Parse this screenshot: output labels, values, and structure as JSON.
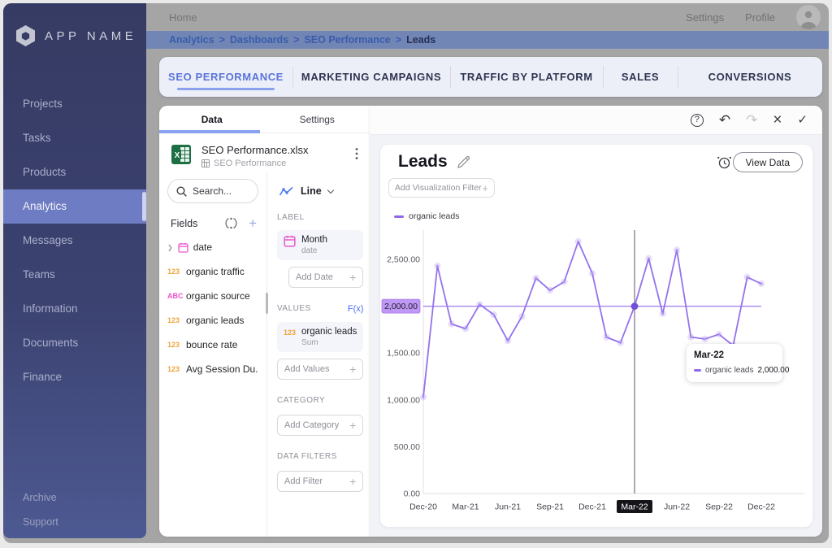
{
  "sidebar": {
    "logo_text": "APP NAME",
    "items": [
      {
        "label": "Projects"
      },
      {
        "label": "Tasks"
      },
      {
        "label": "Products"
      },
      {
        "label": "Analytics",
        "active": true
      },
      {
        "label": "Messages"
      },
      {
        "label": "Teams"
      },
      {
        "label": "Information"
      },
      {
        "label": "Documents"
      },
      {
        "label": "Finance"
      }
    ],
    "footer_items": [
      {
        "label": "Archive"
      },
      {
        "label": "Support"
      }
    ]
  },
  "topbar": {
    "home": "Home",
    "settings": "Settings",
    "profile": "Profile"
  },
  "breadcrumb": {
    "items": [
      "Analytics",
      "Dashboards",
      "SEO Performance"
    ],
    "separator": ">",
    "current": "Leads"
  },
  "tabs": [
    {
      "label": "SEO PERFORMANCE",
      "active": true
    },
    {
      "label": "MARKETING CAMPAIGNS"
    },
    {
      "label": "TRAFFIC BY PLATFORM"
    },
    {
      "label": "SALES"
    },
    {
      "label": "CONVERSIONS"
    }
  ],
  "data_panel": {
    "tabs": [
      "Data",
      "Settings"
    ],
    "file": {
      "name": "SEO Performance.xlsx",
      "sheet": "SEO Performance"
    },
    "search_placeholder": "Search...",
    "fields_label": "Fields",
    "fields": [
      {
        "icon": "calendar",
        "label": "date",
        "expandable": true
      },
      {
        "badge": "123",
        "label": "organic traffic"
      },
      {
        "badge": "ABC",
        "label": "organic source"
      },
      {
        "badge": "123",
        "label": "organic leads"
      },
      {
        "badge": "123",
        "label": "bounce rate"
      },
      {
        "badge": "123",
        "label": "Avg Session Du..."
      }
    ],
    "builder": {
      "chart_type": "Line",
      "label_section": {
        "title": "LABEL",
        "chip_title": "Month",
        "chip_sub": "date",
        "add_label": "Add Date"
      },
      "values_section": {
        "title": "VALUES",
        "fx": "F(x)",
        "chip_badge": "123",
        "chip_title": "organic leads",
        "chip_sub": "Sum",
        "add_label": "Add Values"
      },
      "category_section": {
        "title": "CATEGORY",
        "add_label": "Add Category"
      },
      "filters_section": {
        "title": "DATA FILTERS",
        "add_label": "Add Filter"
      }
    }
  },
  "workspace": {
    "toolbar": [
      {
        "name": "help",
        "glyph": "?"
      },
      {
        "name": "undo",
        "glyph": "↶"
      },
      {
        "name": "redo",
        "glyph": "↷"
      },
      {
        "name": "close",
        "glyph": "×"
      },
      {
        "name": "confirm",
        "glyph": "✓"
      }
    ],
    "title": "Leads",
    "view_data_label": "View Data",
    "filter_placeholder": "Add Visualization Filter",
    "tooltip": {
      "title": "Mar-22",
      "series": "organic leads",
      "value": "2,000.00"
    }
  },
  "chart_data": {
    "type": "line",
    "title": "Leads",
    "legend": [
      "organic leads"
    ],
    "x": [
      "Dec-20",
      "Jan-21",
      "Feb-21",
      "Mar-21",
      "Apr-21",
      "May-21",
      "Jun-21",
      "Jul-21",
      "Aug-21",
      "Sep-21",
      "Oct-21",
      "Nov-21",
      "Dec-21",
      "Jan-22",
      "Feb-22",
      "Mar-22",
      "Apr-22",
      "May-22",
      "Jun-22",
      "Jul-22",
      "Aug-22",
      "Sep-22",
      "Oct-22",
      "Nov-22",
      "Dec-22"
    ],
    "series": [
      {
        "name": "organic leads",
        "values": [
          1030,
          2430,
          1810,
          1760,
          2020,
          1910,
          1630,
          1890,
          2300,
          2170,
          2260,
          2690,
          2350,
          1670,
          1610,
          2000,
          2510,
          1920,
          2600,
          1670,
          1650,
          1700,
          1580,
          2310,
          2240
        ]
      }
    ],
    "x_tick_step": 3,
    "ylim": [
      0,
      2800
    ],
    "yticks": [
      0,
      500,
      1000,
      1500,
      2000,
      2500
    ],
    "ytick_labels": [
      "0.00",
      "500.00",
      "1,000.00",
      "1,500.00",
      "2,000.00",
      "2,500.00"
    ],
    "reference_line_y": 2000,
    "highlight": {
      "x": "Mar-22",
      "value": 2000,
      "y_label": "2,000.00"
    },
    "line_color": "#9472ec"
  }
}
